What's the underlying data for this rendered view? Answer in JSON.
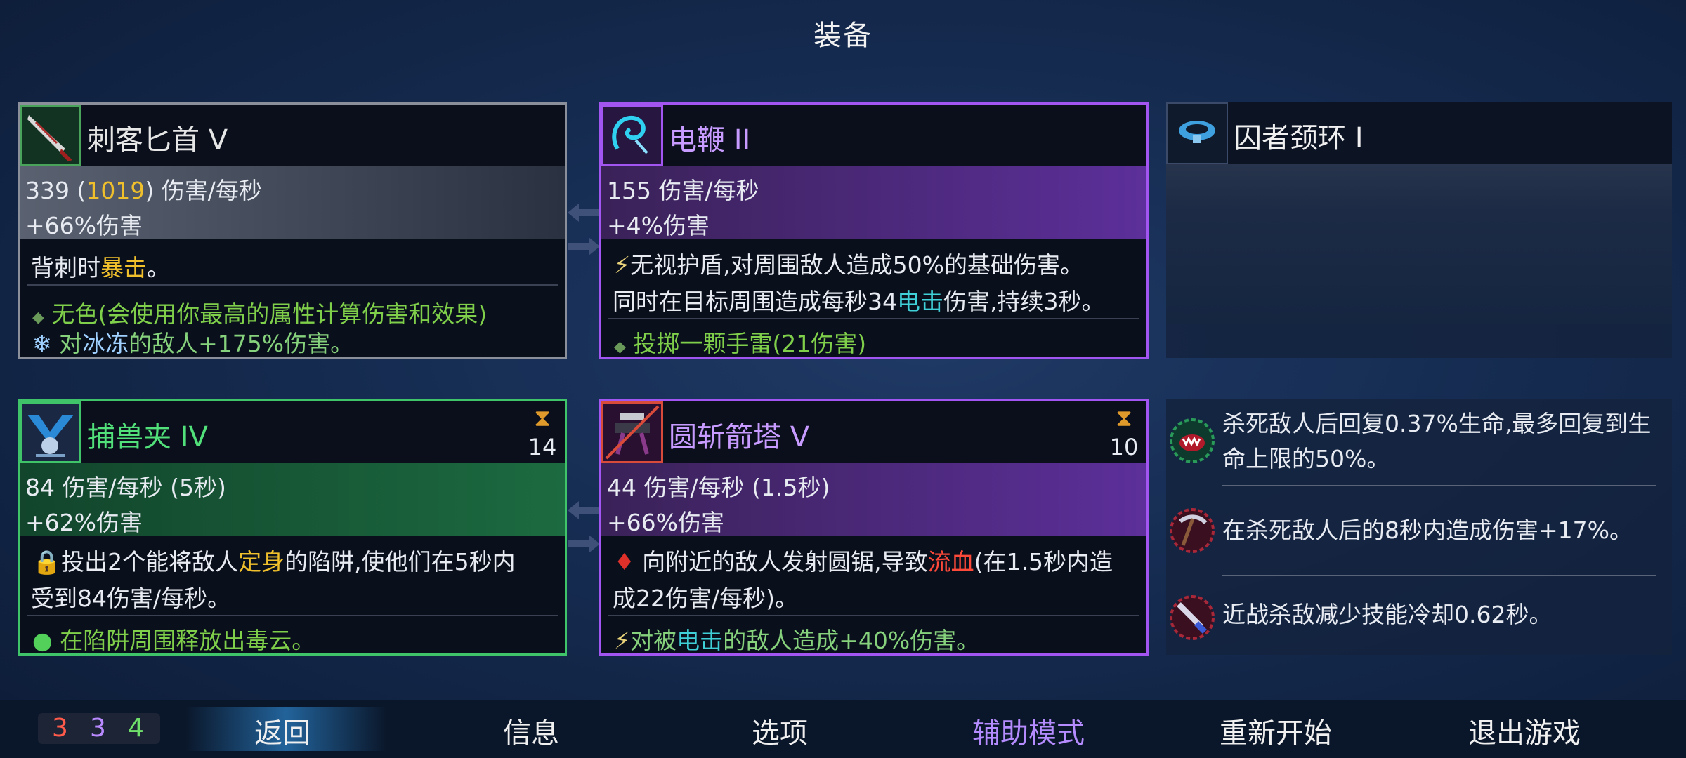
{
  "screen_title": "装备",
  "cards": {
    "dagger": {
      "name": "刺客匕首 V",
      "dps": "339",
      "dps_crit": "1019",
      "dps_unit": "伤害/每秒",
      "bonus": "+66%伤害",
      "desc1_a": "背刺时",
      "desc1_b": "暴击",
      "desc1_c": "。",
      "trait1": "无色(会使用你最高的属性计算伤害和效果)",
      "trait2_a": "对",
      "trait2_b": "冰冻",
      "trait2_c": "的敌人+175%伤害。",
      "border_color": "#8a8f99"
    },
    "whip": {
      "name": "电鞭 II",
      "dps": "155 伤害/每秒",
      "bonus": "+4%伤害",
      "desc1": "无视护盾,对周围敌人造成50%的基础伤害。",
      "desc2_a": "同时在目标周围造成每秒34",
      "desc2_b": "电击",
      "desc2_c": "伤害,持续3秒。",
      "trait1": "投掷一颗手雷(21伤害)",
      "border_color": "#a255f0"
    },
    "collar": {
      "name": "囚者颈环 I"
    },
    "trap": {
      "name": "捕兽夹 IV",
      "cooldown": "14",
      "dps": "84 伤害/每秒 (5秒)",
      "bonus": "+62%伤害",
      "desc1_a": "投出2个能将敌人",
      "desc1_b": "定身",
      "desc1_c": "的陷阱,使他们在5秒内",
      "desc2": "受到84伤害/每秒。",
      "trait1": "在陷阱周围释放出毒云。",
      "border_color": "#3fc46a"
    },
    "turret": {
      "name": "圆斩箭塔 V",
      "cooldown": "10",
      "dps": "44 伤害/每秒 (1.5秒)",
      "bonus": "+66%伤害",
      "desc1_a": "向附近的敌人发射圆锯,导致",
      "desc1_b": "流血",
      "desc1_c": "(在1.5秒内造",
      "desc2": "成22伤害/每秒)。",
      "trait1_a": "对被",
      "trait1_b": "电击",
      "trait1_c": "的敌人造成+40%伤害。",
      "border_color": "#a255f0"
    }
  },
  "perks": [
    {
      "text": "杀死敌人后回复0.37%生命,最多回复到生命上限的50%。",
      "icon": "vampire-mouth-icon"
    },
    {
      "text": "在杀死敌人后的8秒内造成伤害+17%。",
      "icon": "pickaxe-icon"
    },
    {
      "text": "近战杀敌减少技能冷却0.62秒。",
      "icon": "sword-icon"
    }
  ],
  "stats": {
    "brutality": "3",
    "tactics": "3",
    "survival": "4"
  },
  "menu": {
    "back": "返回",
    "info": "信息",
    "options": "选项",
    "assist": "辅助模式",
    "restart": "重新开始",
    "quit": "退出游戏"
  },
  "colors": {
    "red_stat": "#ff5a4a",
    "purple_stat": "#b889ff",
    "green_stat": "#6fe06a",
    "assist_menu": "#b58cff"
  }
}
